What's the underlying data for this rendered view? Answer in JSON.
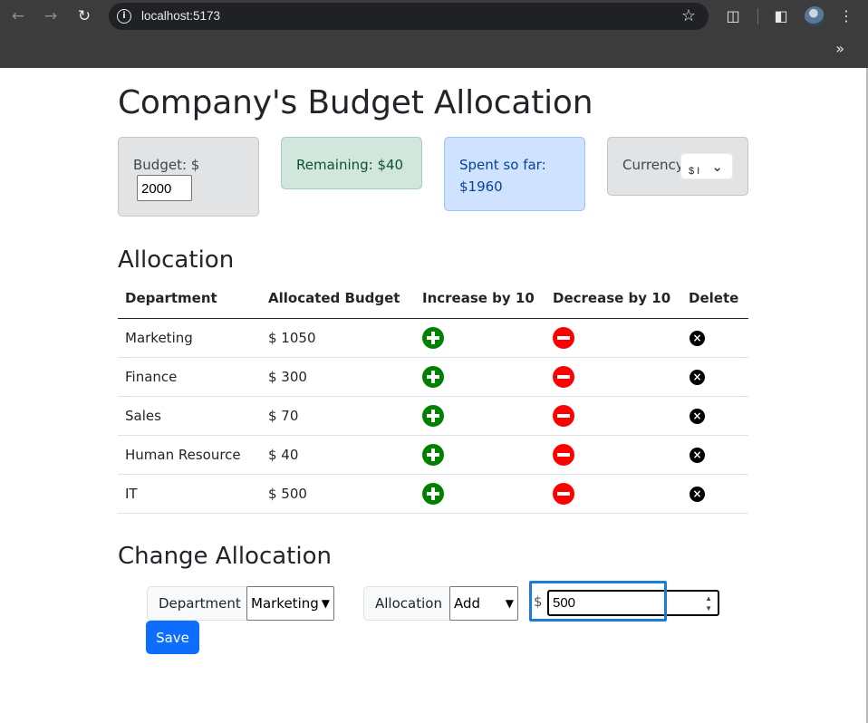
{
  "browser": {
    "url": "localhost:5173",
    "more_label": "»"
  },
  "page": {
    "title": "Company's Budget Allocation",
    "budget": {
      "label": "Budget: $",
      "value": "2000"
    },
    "remaining": {
      "text": "Remaining: $40"
    },
    "spent": {
      "line1": "Spent so far:",
      "line2": "$1960"
    },
    "currency": {
      "label": "Currency",
      "selected": "$ I"
    },
    "allocation_heading": "Allocation",
    "table": {
      "headers": [
        "Department",
        "Allocated Budget",
        "Increase by 10",
        "Decrease by 10",
        "Delete"
      ],
      "rows": [
        {
          "department": "Marketing",
          "budget": "$ 1050"
        },
        {
          "department": "Finance",
          "budget": "$ 300"
        },
        {
          "department": "Sales",
          "budget": "$ 70"
        },
        {
          "department": "Human Resource",
          "budget": "$ 40"
        },
        {
          "department": "IT",
          "budget": "$ 500"
        }
      ]
    },
    "change_heading": "Change Allocation",
    "change_form": {
      "department_label": "Department",
      "department_selected": "Marketing",
      "allocation_label": "Allocation",
      "allocation_selected": "Add",
      "currency_symbol": "$",
      "amount_value": "500",
      "save_label": "Save"
    }
  },
  "colors": {
    "increase_icon": "#008000",
    "decrease_icon": "#ff0000",
    "save_button": "#0d6efd",
    "focus_highlight": "#1a7fd4"
  },
  "icons": {
    "increase": "plus-circle-icon",
    "decrease": "minus-circle-icon",
    "delete": "x-circle-icon"
  }
}
